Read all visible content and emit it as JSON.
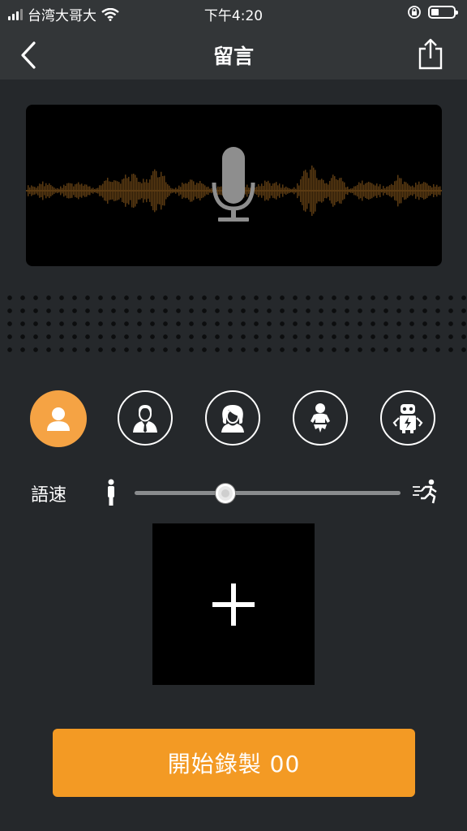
{
  "status": {
    "carrier": "台湾大哥大",
    "time": "下午4:20"
  },
  "nav": {
    "title": "留言",
    "back_icon": "chevron-left-icon",
    "share_icon": "share-icon"
  },
  "recorder": {
    "waveform_color": "#5a3a12",
    "mic_icon": "microphone-icon"
  },
  "voices": [
    {
      "name": "default",
      "icon": "person-icon",
      "active": true
    },
    {
      "name": "man",
      "icon": "man-icon",
      "active": false
    },
    {
      "name": "woman",
      "icon": "woman-icon",
      "active": false
    },
    {
      "name": "baby",
      "icon": "baby-icon",
      "active": false
    },
    {
      "name": "robot",
      "icon": "robot-icon",
      "active": false
    }
  ],
  "speed": {
    "label": "語速",
    "value": 0.34,
    "slow_icon": "walking-icon",
    "fast_icon": "running-icon"
  },
  "add_box": {
    "icon": "plus-icon"
  },
  "record_button": {
    "label": "開始錄製 00"
  },
  "colors": {
    "accent": "#f39a24",
    "active_voice": "#f5a344",
    "background": "#25282b",
    "bar": "#333638"
  }
}
